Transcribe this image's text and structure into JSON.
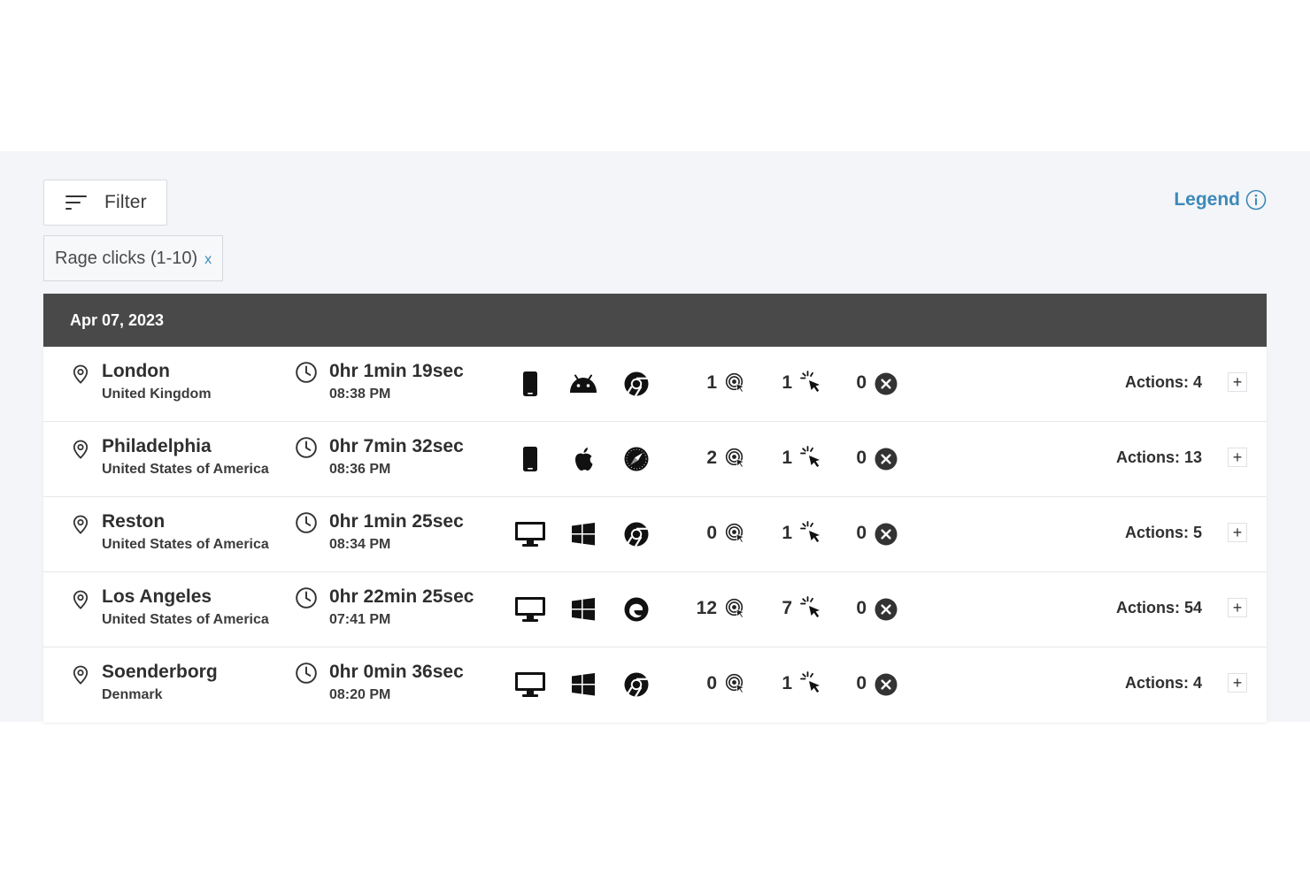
{
  "toolbar": {
    "filter_label": "Filter",
    "legend_label": "Legend"
  },
  "active_filter": {
    "label": "Rage clicks (1-10)",
    "remove": "x"
  },
  "date_group": "Apr 07, 2023",
  "sessions": [
    {
      "city": "London",
      "country": "United Kingdom",
      "duration": "0hr 1min 19sec",
      "time": "08:38 PM",
      "device": "mobile-phone-icon",
      "os": "android-icon",
      "browser": "chrome-icon",
      "metric_1": "1",
      "metric_2": "1",
      "metric_3": "0",
      "actions": "Actions: 4",
      "expand": "+"
    },
    {
      "city": "Philadelphia",
      "country": "United States of America",
      "duration": "0hr 7min 32sec",
      "time": "08:36 PM",
      "device": "mobile-phone-icon",
      "os": "apple-icon",
      "browser": "safari-icon",
      "metric_1": "2",
      "metric_2": "1",
      "metric_3": "0",
      "actions": "Actions: 13",
      "expand": "+"
    },
    {
      "city": "Reston",
      "country": "United States of America",
      "duration": "0hr 1min 25sec",
      "time": "08:34 PM",
      "device": "desktop-icon",
      "os": "windows-icon",
      "browser": "chrome-icon",
      "metric_1": "0",
      "metric_2": "1",
      "metric_3": "0",
      "actions": "Actions: 5",
      "expand": "+"
    },
    {
      "city": "Los Angeles",
      "country": "United States of America",
      "duration": "0hr 22min 25sec",
      "time": "07:41 PM",
      "device": "desktop-icon",
      "os": "windows-icon",
      "browser": "edge-icon",
      "metric_1": "12",
      "metric_2": "7",
      "metric_3": "0",
      "actions": "Actions: 54",
      "expand": "+"
    },
    {
      "city": "Soenderborg",
      "country": "Denmark",
      "duration": "0hr 0min 36sec",
      "time": "08:20 PM",
      "device": "desktop-icon",
      "os": "windows-icon",
      "browser": "chrome-icon",
      "metric_1": "0",
      "metric_2": "1",
      "metric_3": "0",
      "actions": "Actions: 4",
      "expand": "+"
    }
  ],
  "colors": {
    "accent": "#3d89b8",
    "header_bg": "#494949",
    "panel_bg": "#f4f5f8"
  }
}
